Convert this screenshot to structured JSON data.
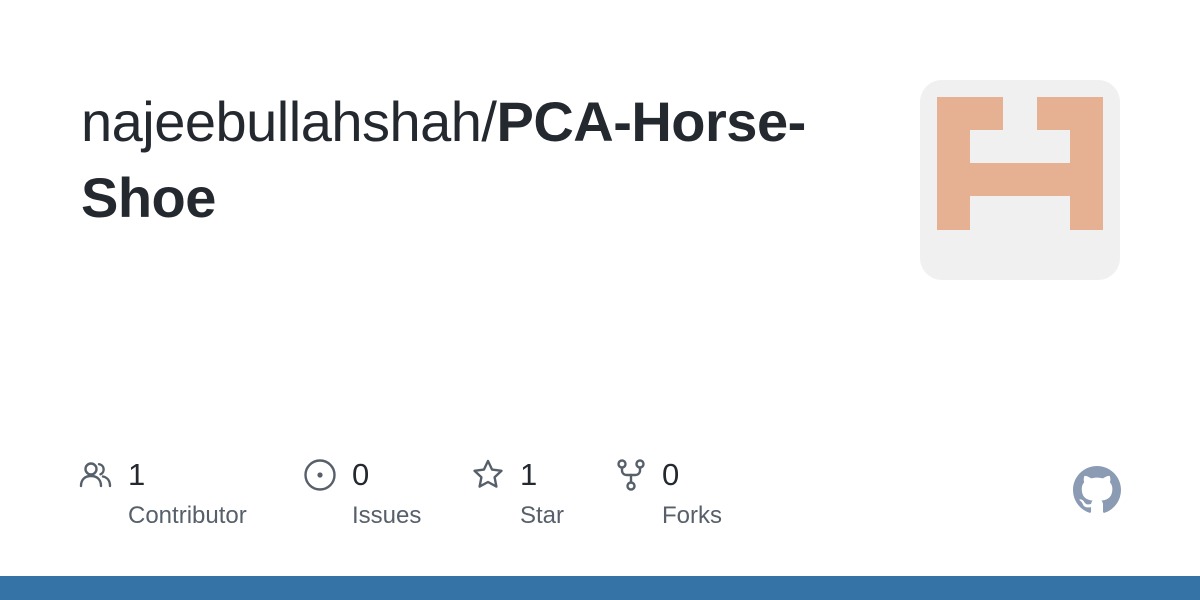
{
  "repo": {
    "owner": "najeebullahshah",
    "separator": "/",
    "name": "PCA-Horse-Shoe"
  },
  "avatar": {
    "icon": "identicon",
    "background": "#f0f0f0",
    "pattern_color": "#e6b092"
  },
  "stats": {
    "contributors": {
      "count": "1",
      "label": "Contributor",
      "icon": "people-icon"
    },
    "issues": {
      "count": "0",
      "label": "Issues",
      "icon": "issue-opened-icon"
    },
    "stars": {
      "count": "1",
      "label": "Star",
      "icon": "star-icon"
    },
    "forks": {
      "count": "0",
      "label": "Forks",
      "icon": "repo-forked-icon"
    }
  },
  "brand": {
    "icon": "github-mark-icon",
    "language_bar_color": "#3572a5"
  }
}
